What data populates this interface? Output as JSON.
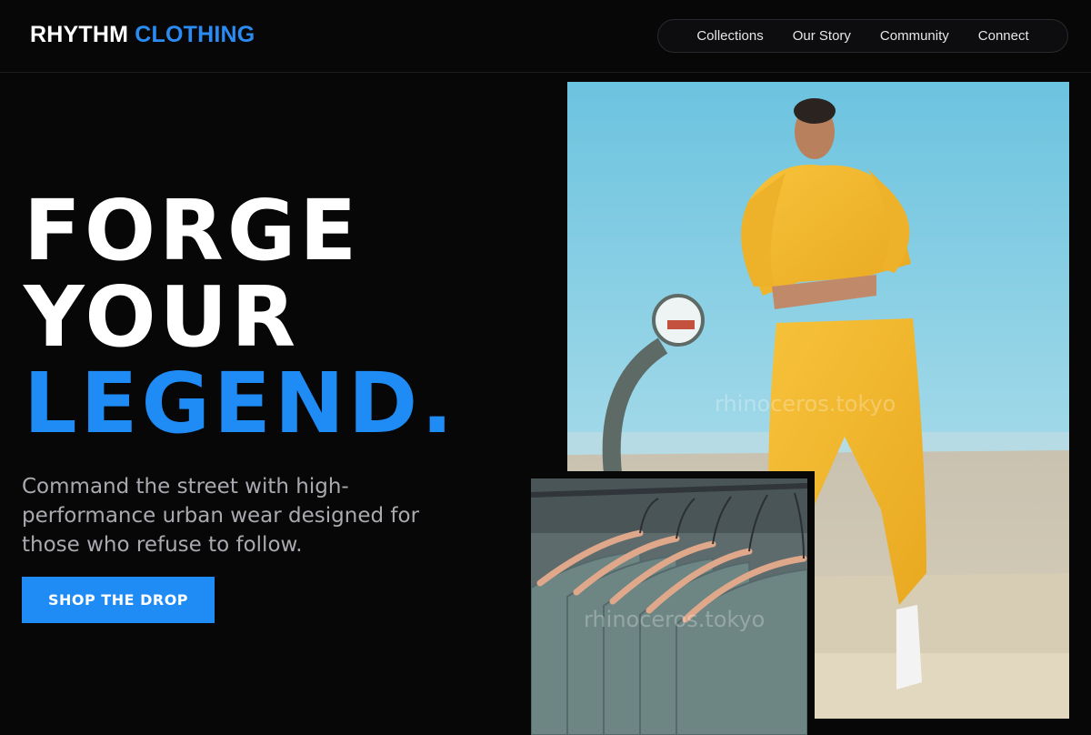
{
  "brand": {
    "name_primary": "RHYTHM",
    "name_accent": "CLOTHING"
  },
  "nav": {
    "items": [
      {
        "label": "Collections"
      },
      {
        "label": "Our Story"
      },
      {
        "label": "Community"
      },
      {
        "label": "Connect"
      }
    ]
  },
  "hero": {
    "title_line1": "FORGE",
    "title_line2": "YOUR",
    "title_line3": "LEGEND.",
    "subtitle": "Command the street with high-performance urban wear designed for those who refuse to follow.",
    "cta_label": "SHOP THE DROP"
  },
  "images": {
    "main_watermark": "rhinoceros.tokyo",
    "secondary_watermark": "rhinoceros.tokyo"
  },
  "colors": {
    "background": "#070708",
    "accent": "#1f8bf5",
    "subtitle_text": "#a9aab0",
    "hoodie_yellow": "#f2b62c"
  }
}
